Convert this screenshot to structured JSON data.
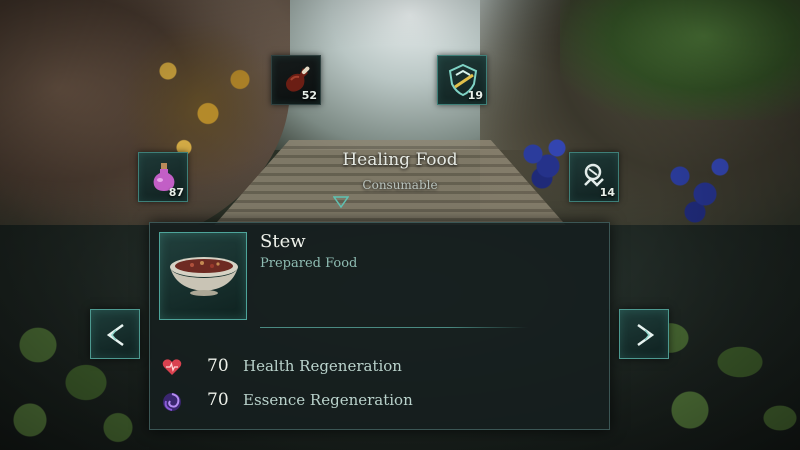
{
  "item_wheel": {
    "slots": [
      {
        "name": "meat",
        "icon": "meat-leg-icon",
        "count": "52"
      },
      {
        "name": "shield",
        "icon": "shield-crest-icon",
        "count": "19"
      },
      {
        "name": "potion",
        "icon": "potion-flask-icon",
        "count": "87"
      },
      {
        "name": "rune",
        "icon": "rune-sigil-icon",
        "count": "14"
      }
    ],
    "category": {
      "title": "Healing Food",
      "subtitle": "Consumable"
    }
  },
  "detail": {
    "name": "Stew",
    "type": "Prepared Food",
    "icon": "stew-bowl-icon",
    "stats": [
      {
        "icon": "heart-icon",
        "value": "70",
        "label": "Health Regeneration"
      },
      {
        "icon": "essence-swirl-icon",
        "value": "70",
        "label": "Essence Regeneration"
      }
    ]
  },
  "navigation": {
    "prev_icon": "chevron-left-icon",
    "next_icon": "chevron-right-icon"
  },
  "colors": {
    "accent_teal": "#4ea49a",
    "panel_bg": "#161e1e",
    "text_primary": "#eef1ea",
    "text_secondary": "#8fbdb3",
    "health_red": "#d9414f",
    "essence_purple": "#8a5bd6"
  }
}
